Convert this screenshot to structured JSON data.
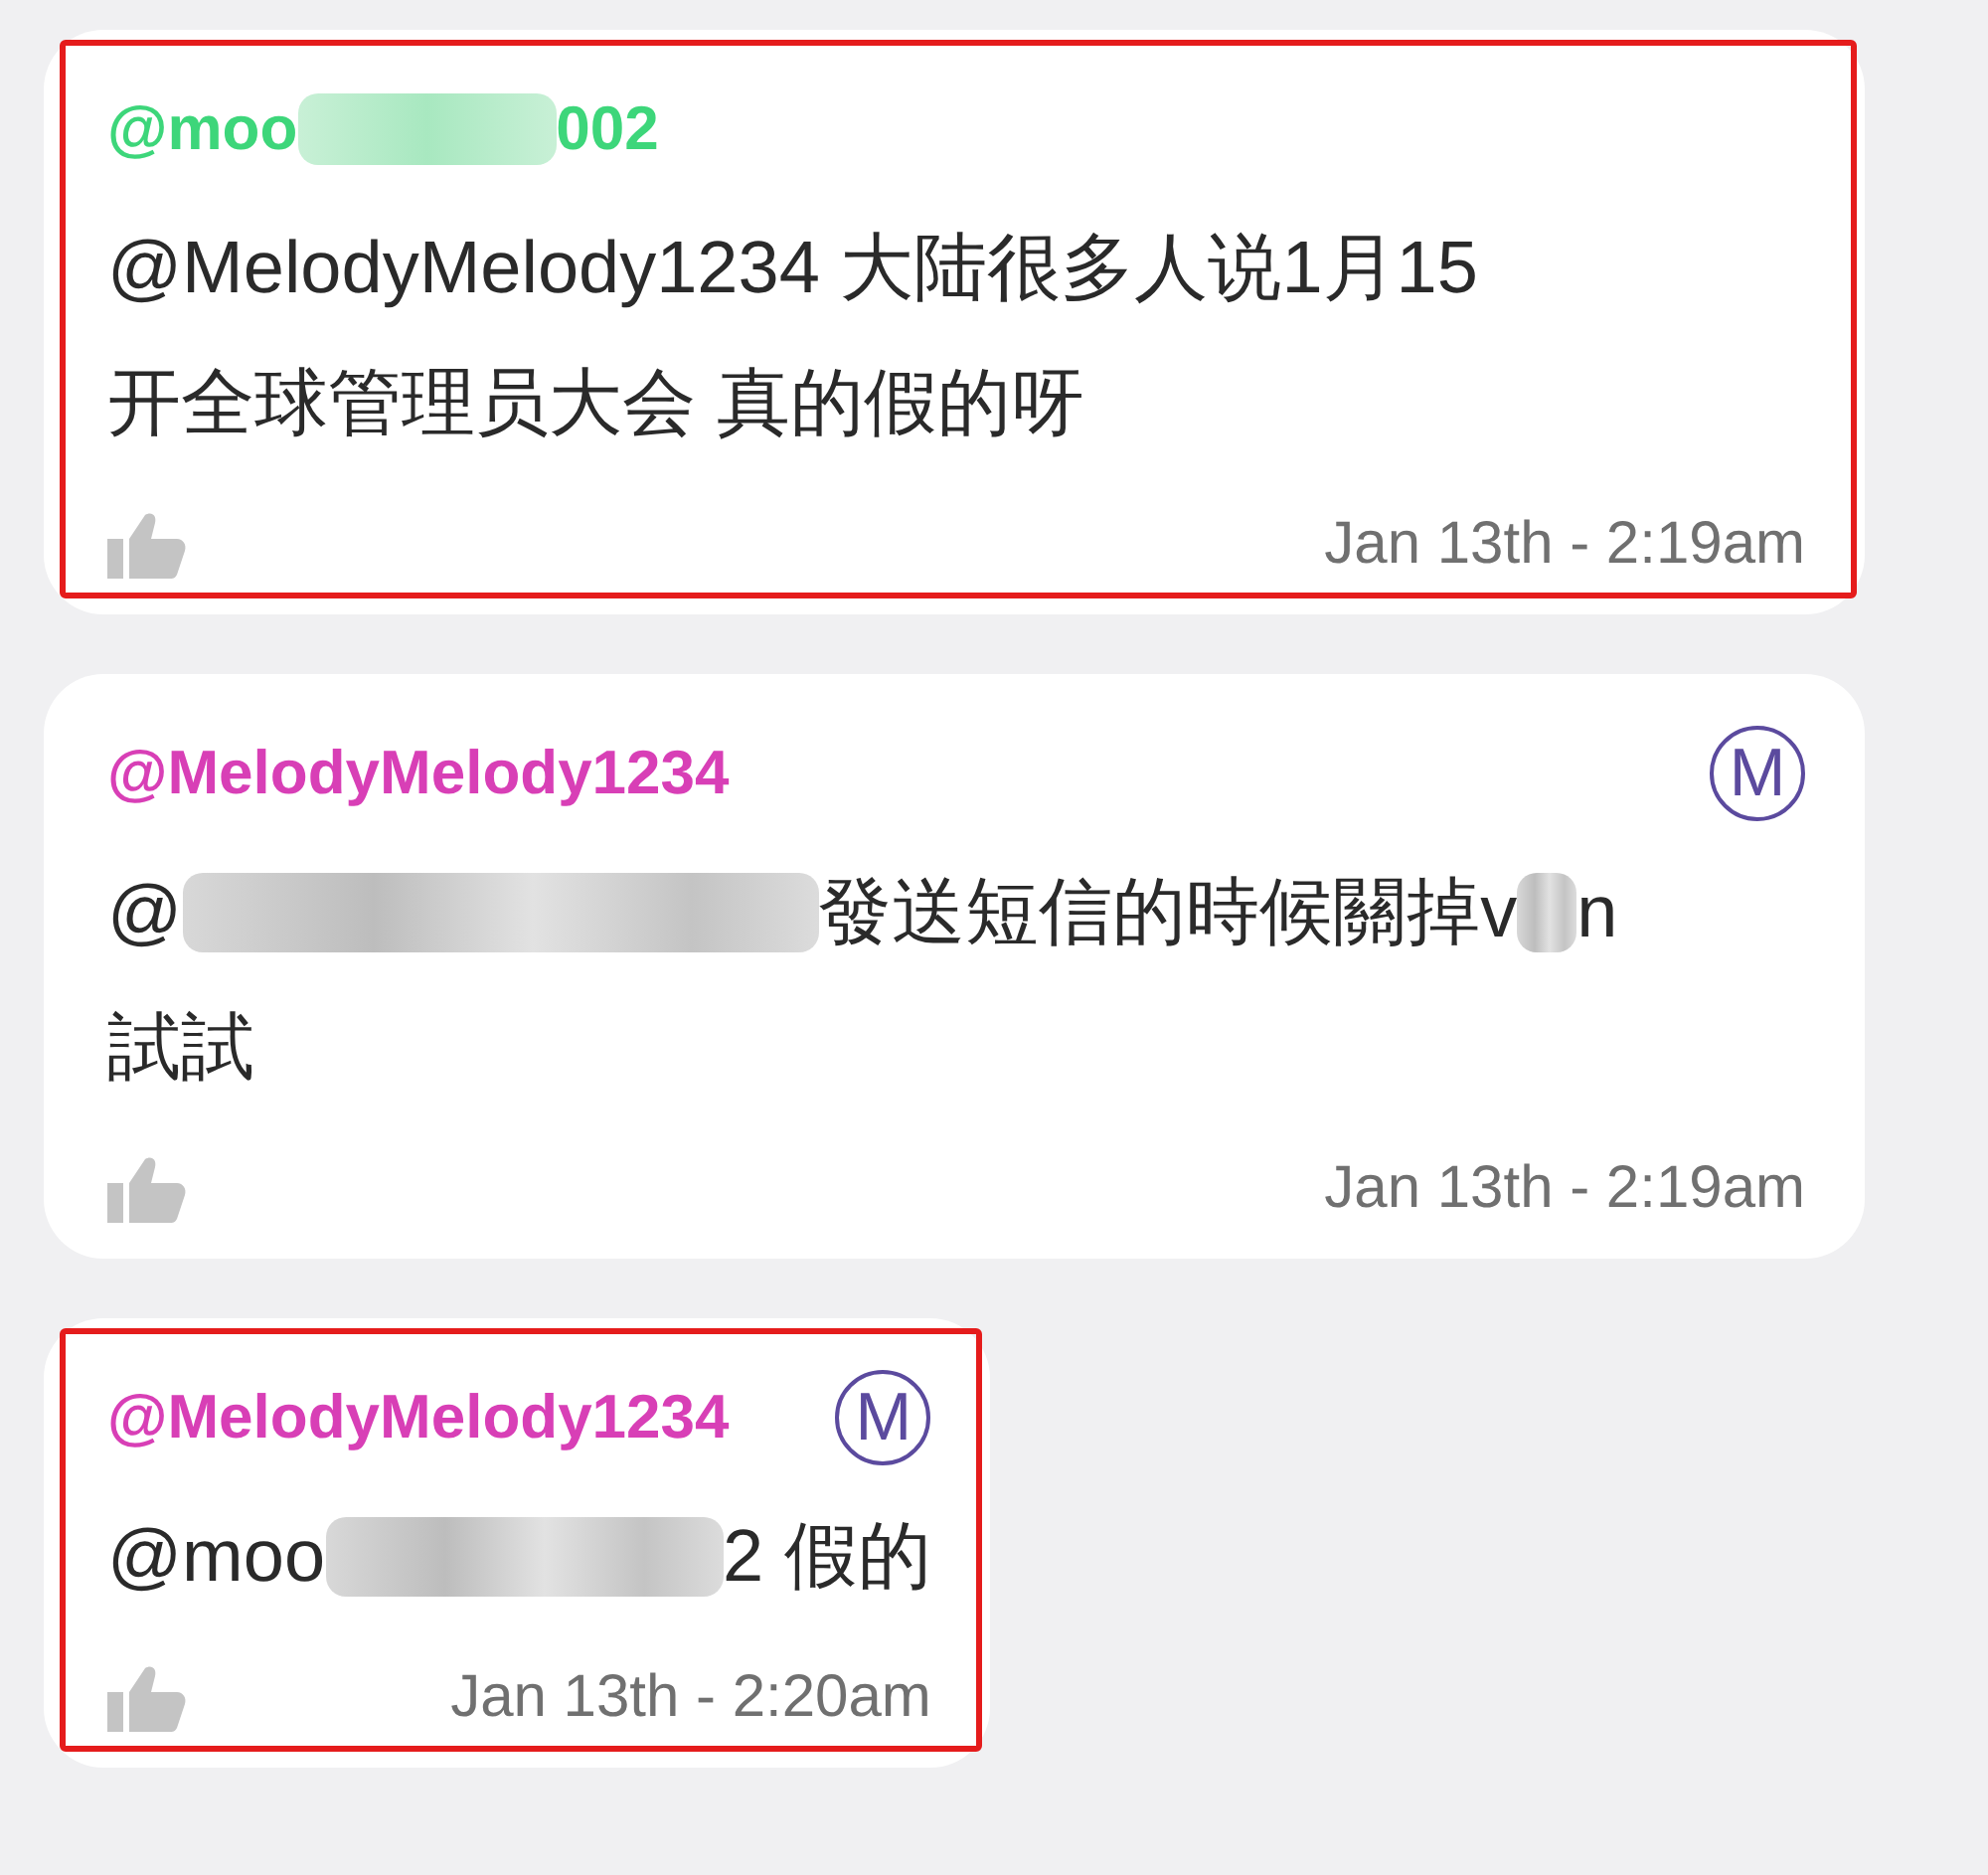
{
  "messages": [
    {
      "author": [
        {
          "kind": "text",
          "text": "@moo"
        },
        {
          "kind": "redacted"
        },
        {
          "kind": "text",
          "text": "002"
        }
      ],
      "color": "#3dd67a",
      "highlighted": true,
      "full_width": true,
      "body": [
        [
          {
            "kind": "text",
            "text": "@MelodyMelody1234 大陆很多人说1月15"
          }
        ],
        [
          {
            "kind": "text",
            "text": "开全球管理员大会 真的假的呀"
          }
        ]
      ],
      "time": "Jan 13th - 2:19am"
    },
    {
      "author": [
        {
          "kind": "text",
          "text": "@MelodyMelody1234"
        }
      ],
      "color": "#d83fb6",
      "badge": "M",
      "highlighted": false,
      "full_width": true,
      "body": [
        [
          {
            "kind": "text",
            "text": "@"
          },
          {
            "kind": "redacted"
          },
          {
            "kind": "text",
            "text": "發送短信的時候關掉v"
          },
          {
            "kind": "redacted"
          },
          {
            "kind": "text",
            "text": "n"
          }
        ],
        [
          {
            "kind": "text",
            "text": "試試"
          }
        ]
      ],
      "time": "Jan 13th - 2:19am"
    },
    {
      "author": [
        {
          "kind": "text",
          "text": "@MelodyMelody1234"
        }
      ],
      "color": "#d83fb6",
      "badge": "M",
      "highlighted": true,
      "full_width": false,
      "body": [
        [
          {
            "kind": "text",
            "text": "@moo"
          },
          {
            "kind": "redacted"
          },
          {
            "kind": "text",
            "text": "2 假的"
          }
        ]
      ],
      "time": "Jan 13th - 2:20am"
    }
  ]
}
